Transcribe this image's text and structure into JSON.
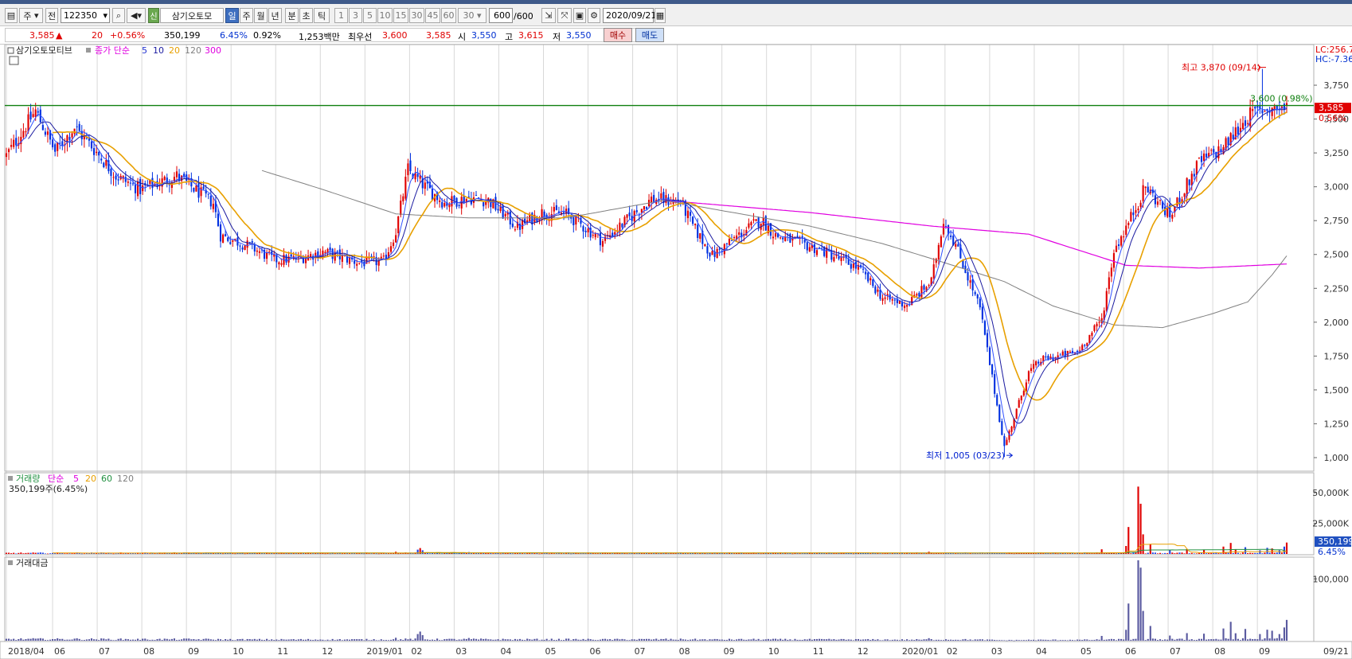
{
  "toolbar": {
    "period_select": "주",
    "prev_label": "전",
    "code": "122350",
    "name": "삼기오토모",
    "badge": "신",
    "periods": [
      "일",
      "주",
      "월",
      "년",
      "분",
      "초",
      "틱"
    ],
    "minutes": [
      "1",
      "3",
      "5",
      "10",
      "15",
      "30",
      "45",
      "60"
    ],
    "interval": "30",
    "count": "600",
    "count_total": "/600",
    "date": "2020/09/21"
  },
  "quote": {
    "price": "3,585",
    "change_arrow": "▲",
    "change": "20",
    "change_pct": "+0.56%",
    "volume": "350,199",
    "vol_ratio": "6.45%",
    "turnover": "0.92%",
    "amount": "1,253백만",
    "best_label": "최우선",
    "best_ask": "3,600",
    "best_bid": "3,585",
    "open_label": "시",
    "open": "3,550",
    "high_label": "고",
    "high": "3,615",
    "low_label": "저",
    "low": "3,550",
    "buy_label": "매수",
    "sell_label": "매도"
  },
  "price_panel": {
    "title": "삼기오토모티브",
    "ma_label": "종가 단순",
    "ma_periods": [
      "5",
      "10",
      "20",
      "120",
      "300"
    ],
    "ma_colors": [
      "#2030d0",
      "#1a1aa0",
      "#e8a000",
      "#808080",
      "#e000e0"
    ],
    "high_annotation": "최고 3,870 (09/14)",
    "low_annotation": "최저 1,005 (03/23)",
    "hline_label": "3,600 (0.98%)",
    "right_top1": "LC:256.7",
    "right_top2": "HC:-7.36",
    "last_price_tag": "3,585",
    "last_change_tag": "0.56%"
  },
  "volume_panel": {
    "title": "거래량",
    "ma_label": "단순",
    "ma_periods": [
      "5",
      "20",
      "60",
      "120"
    ],
    "ma_colors": [
      "#e000e0",
      "#e8a000",
      "#209040",
      "#808080"
    ],
    "info": "350,199주(6.45%)",
    "last_tag": "350,199",
    "pct_tag": "6.45%"
  },
  "amount_panel": {
    "title": "거래대금"
  },
  "chart_data": {
    "type": "candlestick",
    "title": "삼기오토모티브",
    "y_axis_price": {
      "ticks": [
        1000,
        1250,
        1500,
        1750,
        2000,
        2250,
        2500,
        2750,
        3000,
        3250,
        3500,
        3750
      ],
      "labels": [
        "1,000",
        "1,250",
        "1,500",
        "1,750",
        "2,000",
        "2,250",
        "2,500",
        "2,750",
        "3,000",
        "3,250",
        "3,500",
        "3,750"
      ],
      "range": [
        900,
        4050
      ]
    },
    "y_axis_volume": {
      "ticks": [
        25000,
        50000
      ],
      "labels": [
        "25,000K",
        "50,000K"
      ],
      "range": [
        0,
        65000
      ]
    },
    "y_axis_amount": {
      "ticks": [
        100000
      ],
      "labels": [
        "100,000"
      ],
      "range": [
        0,
        130000
      ]
    },
    "x_labels": [
      "2018/04",
      "06",
      "07",
      "08",
      "09",
      "10",
      "11",
      "12",
      "2019/01",
      "02",
      "03",
      "04",
      "05",
      "06",
      "07",
      "08",
      "09",
      "10",
      "11",
      "12",
      "2020/01",
      "02",
      "03",
      "04",
      "05",
      "06",
      "07",
      "08",
      "09",
      "09/21"
    ],
    "horizontal_line": 3600,
    "highest": {
      "value": 3870,
      "date": "09/14"
    },
    "lowest": {
      "value": 1005,
      "date": "03/23"
    },
    "price_anchors": [
      [
        0,
        3230
      ],
      [
        12,
        3560
      ],
      [
        20,
        3260
      ],
      [
        28,
        3440
      ],
      [
        35,
        3300
      ],
      [
        45,
        3080
      ],
      [
        55,
        2980
      ],
      [
        70,
        3080
      ],
      [
        85,
        2880
      ],
      [
        88,
        2640
      ],
      [
        100,
        2560
      ],
      [
        110,
        2460
      ],
      [
        120,
        2470
      ],
      [
        130,
        2520
      ],
      [
        145,
        2440
      ],
      [
        155,
        2450
      ],
      [
        160,
        2670
      ],
      [
        165,
        3130
      ],
      [
        172,
        3000
      ],
      [
        180,
        2880
      ],
      [
        190,
        2920
      ],
      [
        198,
        2900
      ],
      [
        210,
        2700
      ],
      [
        220,
        2810
      ],
      [
        230,
        2800
      ],
      [
        245,
        2600
      ],
      [
        256,
        2770
      ],
      [
        265,
        2910
      ],
      [
        277,
        2890
      ],
      [
        282,
        2710
      ],
      [
        290,
        2490
      ],
      [
        300,
        2630
      ],
      [
        310,
        2760
      ],
      [
        316,
        2640
      ],
      [
        335,
        2530
      ],
      [
        350,
        2400
      ],
      [
        360,
        2180
      ],
      [
        370,
        2130
      ],
      [
        380,
        2300
      ],
      [
        385,
        2760
      ],
      [
        390,
        2570
      ],
      [
        400,
        2100
      ],
      [
        410,
        1080
      ],
      [
        415,
        1350
      ],
      [
        420,
        1630
      ],
      [
        425,
        1720
      ],
      [
        440,
        1780
      ],
      [
        450,
        2020
      ],
      [
        455,
        2530
      ],
      [
        460,
        2700
      ],
      [
        468,
        3000
      ],
      [
        478,
        2780
      ],
      [
        490,
        3180
      ],
      [
        500,
        3290
      ],
      [
        510,
        3520
      ],
      [
        516,
        3570
      ],
      [
        520,
        3580
      ],
      [
        526,
        3585
      ]
    ],
    "ma120_anchors": [
      [
        105,
        3120
      ],
      [
        130,
        2980
      ],
      [
        160,
        2800
      ],
      [
        190,
        2770
      ],
      [
        230,
        2770
      ],
      [
        270,
        2900
      ],
      [
        330,
        2710
      ],
      [
        360,
        2580
      ],
      [
        380,
        2470
      ],
      [
        410,
        2300
      ],
      [
        430,
        2120
      ],
      [
        455,
        1980
      ],
      [
        475,
        1960
      ],
      [
        495,
        2060
      ],
      [
        510,
        2150
      ],
      [
        520,
        2350
      ],
      [
        526,
        2490
      ]
    ],
    "ma300_anchors": [
      [
        270,
        2900
      ],
      [
        330,
        2810
      ],
      [
        380,
        2710
      ],
      [
        420,
        2650
      ],
      [
        460,
        2420
      ],
      [
        490,
        2400
      ],
      [
        526,
        2430
      ]
    ],
    "volume_spikes": [
      [
        160,
        1800
      ],
      [
        169,
        3500
      ],
      [
        170,
        4800
      ],
      [
        171,
        3000
      ],
      [
        190,
        1500
      ],
      [
        195,
        1200
      ],
      [
        270,
        900
      ],
      [
        379,
        1800
      ],
      [
        380,
        1100
      ],
      [
        450,
        3800
      ],
      [
        460,
        6500
      ],
      [
        461,
        22000
      ],
      [
        465,
        55000
      ],
      [
        466,
        41000
      ],
      [
        467,
        16000
      ],
      [
        470,
        8000
      ],
      [
        478,
        3000
      ],
      [
        485,
        4000
      ],
      [
        492,
        3500
      ],
      [
        500,
        6000
      ],
      [
        503,
        9000
      ],
      [
        505,
        3500
      ],
      [
        509,
        5500
      ],
      [
        515,
        3000
      ],
      [
        518,
        5000
      ],
      [
        520,
        4500
      ],
      [
        523,
        3000
      ],
      [
        525,
        6000
      ],
      [
        526,
        9300
      ]
    ],
    "last_volume": 350199,
    "last_volume_pct": 6.45
  }
}
